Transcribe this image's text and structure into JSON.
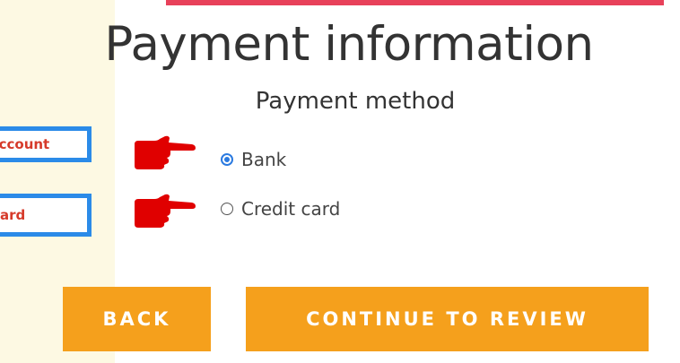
{
  "page": {
    "title": "Payment information",
    "subtitle": "Payment method"
  },
  "annotations": {
    "callout_bank": "Account",
    "callout_card": "Card",
    "pointer_icon": "pointing-hand-icon",
    "pointer_color": "#e00000",
    "callout_border_color": "#2b8be8",
    "callout_text_color": "#d63a2a"
  },
  "payment_methods": [
    {
      "label": "Bank",
      "selected": true
    },
    {
      "label": "Credit card",
      "selected": false
    }
  ],
  "buttons": {
    "back_label": "BACK",
    "continue_label": "CONTINUE TO REVIEW",
    "color": "#f5a01c"
  },
  "colors": {
    "accent_bar": "#e8415a",
    "page_background": "#fdf9e3",
    "radio_selected": "#2b7ae0"
  }
}
